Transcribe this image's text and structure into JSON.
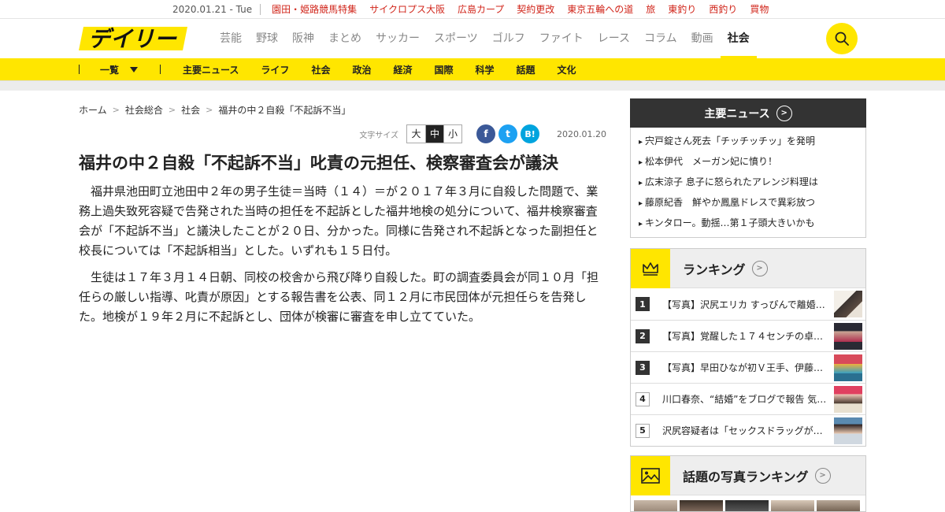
{
  "topbar": {
    "date": "2020.01.21 - Tue",
    "links": [
      "園田・姫路競馬特集",
      "サイクロプス大阪",
      "広島カープ",
      "契約更改",
      "東京五輪への道",
      "旅",
      "東釣り",
      "西釣り",
      "買物"
    ]
  },
  "header": {
    "logo_text": "デイリー",
    "nav": [
      "芸能",
      "野球",
      "阪神",
      "まとめ",
      "サッカー",
      "スポーツ",
      "ゴルフ",
      "ファイト",
      "レース",
      "コラム",
      "動画",
      "社会"
    ],
    "active_nav": "社会",
    "search_icon": "search-icon"
  },
  "subnav": {
    "ichiran": "一覧",
    "items": [
      "主要ニュース",
      "ライフ",
      "社会",
      "政治",
      "経済",
      "国際",
      "科学",
      "話題",
      "文化"
    ]
  },
  "breadcrumb": [
    "ホーム",
    "社会総合",
    "社会",
    "福井の中２自殺「不起訴不当」"
  ],
  "meta": {
    "font_size_label": "文字サイズ",
    "font_sizes": [
      "大",
      "中",
      "小"
    ],
    "active_font_size": "中",
    "share": [
      "f",
      "t",
      "B!"
    ],
    "pub_date": "2020.01.20"
  },
  "article": {
    "headline": "福井の中２自殺「不起訴不当」叱責の元担任、検察審査会が議決",
    "paragraphs": [
      "福井県池田町立池田中２年の男子生徒＝当時（１４）＝が２０１７年３月に自殺した問題で、業務上過失致死容疑で告発された当時の担任を不起訴とした福井地検の処分について、福井検察審査会が「不起訴不当」と議決したことが２０日、分かった。同様に告発され不起訴となった副担任と校長については「不起訴相当」とした。いずれも１５日付。",
      "生徒は１７年３月１４日朝、同校の校舎から飛び降り自殺した。町の調査委員会が同１０月「担任らの厳しい指導、叱責が原因」とする報告書を公表、同１２月に市民団体が元担任らを告発した。地検が１９年２月に不起訴とし、団体が検審に審査を申し立てていた。"
    ]
  },
  "sidebar": {
    "main_news": {
      "title": "主要ニュース",
      "items": [
        "宍戸錠さん死去「チッチッチッ」を発明",
        "松本伊代　メーガン妃に憤り！",
        "広末涼子 息子に怒られたアレンジ料理は",
        "藤原紀香　鮮やか鳳凰ドレスで異彩放つ",
        "キンタロー。動揺…第１子頭大きいかも"
      ]
    },
    "ranking": {
      "title": "ランキング",
      "items": [
        {
          "num": "1",
          "text": "【写真】沢尻エリカ すっぴんで離婚…"
        },
        {
          "num": "2",
          "text": "【写真】覚醒した１７４センチの卓球…"
        },
        {
          "num": "3",
          "text": "【写真】早田ひなが初Ｖ王手、伊藤美…"
        },
        {
          "num": "4",
          "text": "川口春奈、“結婚”をブログで報告 気に…"
        },
        {
          "num": "5",
          "text": "沢尻容疑者は「セックスドラッグが多…"
        }
      ]
    },
    "photo_ranking": {
      "title": "話題の写真ランキング"
    }
  },
  "colors": {
    "brand_yellow": "#ffe600",
    "topbar_link": "#d1261b",
    "dark": "#333333"
  }
}
